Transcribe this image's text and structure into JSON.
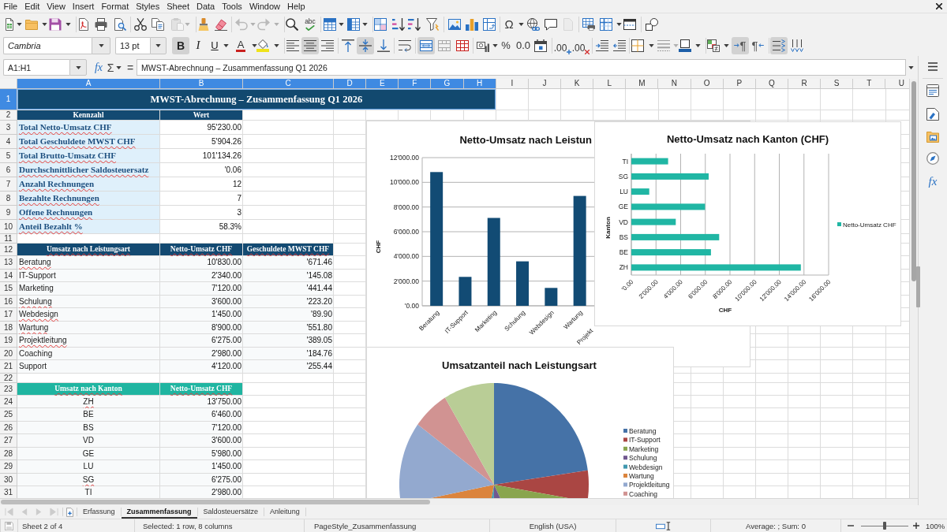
{
  "menu_bar": {
    "items": [
      "File",
      "Edit",
      "View",
      "Insert",
      "Format",
      "Styles",
      "Sheet",
      "Data",
      "Tools",
      "Window",
      "Help"
    ]
  },
  "standard_toolbar": {
    "paste_disabled": true,
    "undo_disabled": true,
    "redo_disabled": true,
    "spelling_glyph": "abc",
    "special_character_glyph": "Ω",
    "header_footer_disabled": true
  },
  "formatting_toolbar": {
    "font_name": "Cambria",
    "font_size": "13 pt",
    "bold": {
      "glyph": "B",
      "on": true
    },
    "italic": {
      "glyph": "I",
      "on": false
    },
    "underline": {
      "glyph": "U",
      "on": false
    },
    "font_color_glyph": "A",
    "align_left": false,
    "align_center": true,
    "align_right": false,
    "align_top": false,
    "align_middle": true,
    "align_bottom": false,
    "wrap_text": false,
    "merge_and_center": true,
    "percent_glyph": "%",
    "number_glyph": "0.0",
    "add_decimal_glyph": ".00",
    "delete_decimal_glyph": ".00",
    "left_to_right": {
      "glyph": "¶",
      "on": true
    },
    "right_to_left": {
      "glyph": "¶",
      "on": false
    },
    "text_left_to_right": true,
    "text_vertical": false
  },
  "formula_bar": {
    "name_box": "A1:H1",
    "function_wizard_glyph": "fx",
    "sum_glyph": "Σ",
    "formula_glyph": "=",
    "content": "MWST-Abrechnung – Zusammenfassung Q1 2026"
  },
  "sidebar": {
    "functions_glyph": "fx"
  },
  "sheet": {
    "columns": [
      {
        "label": "A",
        "selected": true
      },
      {
        "label": "B",
        "selected": true
      },
      {
        "label": "C",
        "selected": true
      },
      {
        "label": "D",
        "selected": true
      },
      {
        "label": "E",
        "selected": true
      },
      {
        "label": "F",
        "selected": true
      },
      {
        "label": "G",
        "selected": true
      },
      {
        "label": "H",
        "selected": true
      },
      {
        "label": "I",
        "selected": false
      },
      {
        "label": "J",
        "selected": false
      },
      {
        "label": "K",
        "selected": false
      },
      {
        "label": "L",
        "selected": false
      },
      {
        "label": "M",
        "selected": false
      },
      {
        "label": "N",
        "selected": false
      },
      {
        "label": "O",
        "selected": false
      },
      {
        "label": "P",
        "selected": false
      },
      {
        "label": "Q",
        "selected": false
      },
      {
        "label": "R",
        "selected": false
      },
      {
        "label": "S",
        "selected": false
      },
      {
        "label": "T",
        "selected": false
      },
      {
        "label": "U",
        "selected": false
      }
    ],
    "rows": [
      {
        "label": "1",
        "selected": true
      },
      {
        "label": "2",
        "selected": false
      },
      {
        "label": "3",
        "selected": false
      },
      {
        "label": "4",
        "selected": false
      },
      {
        "label": "5",
        "selected": false
      },
      {
        "label": "6",
        "selected": false
      },
      {
        "label": "7",
        "selected": false
      },
      {
        "label": "8",
        "selected": false
      },
      {
        "label": "9",
        "selected": false
      },
      {
        "label": "10",
        "selected": false
      },
      {
        "label": "11",
        "selected": false
      },
      {
        "label": "12",
        "selected": false
      },
      {
        "label": "13",
        "selected": false
      },
      {
        "label": "14",
        "selected": false
      },
      {
        "label": "15",
        "selected": false
      },
      {
        "label": "16",
        "selected": false
      },
      {
        "label": "17",
        "selected": false
      },
      {
        "label": "18",
        "selected": false
      },
      {
        "label": "19",
        "selected": false
      },
      {
        "label": "20",
        "selected": false
      },
      {
        "label": "21",
        "selected": false
      },
      {
        "label": "22",
        "selected": false
      },
      {
        "label": "23",
        "selected": false
      },
      {
        "label": "24",
        "selected": false
      },
      {
        "label": "25",
        "selected": false
      },
      {
        "label": "26",
        "selected": false
      },
      {
        "label": "27",
        "selected": false
      },
      {
        "label": "28",
        "selected": false
      },
      {
        "label": "29",
        "selected": false
      },
      {
        "label": "30",
        "selected": false
      },
      {
        "label": "31",
        "selected": false
      }
    ],
    "title": {
      "text": "MWST-Abrechnung – Zusammenfassung Q1 2026",
      "selected": true
    },
    "tables": [
      {
        "kind": "kpi",
        "header": [
          {
            "text": "Kennzahl",
            "spelling_marked": false
          },
          {
            "text": "Wert",
            "spelling_marked": false
          }
        ],
        "rows": [
          {
            "cells": [
              "Total Netto-Umsatz CHF",
              "95'230.00"
            ],
            "spelling_marked": true
          },
          {
            "cells": [
              "Total Geschuldete MWST CHF",
              "5'904.26"
            ],
            "spelling_marked": true
          },
          {
            "cells": [
              "Total Brutto-Umsatz CHF",
              "101'134.26"
            ],
            "spelling_marked": true
          },
          {
            "cells": [
              "Durchschnittlicher Saldosteuersatz",
              "'0.06"
            ],
            "spelling_marked": true
          },
          {
            "cells": [
              "Anzahl Rechnungen",
              "12"
            ],
            "spelling_marked": true
          },
          {
            "cells": [
              "Bezahlte Rechnungen",
              "7"
            ],
            "spelling_marked": true
          },
          {
            "cells": [
              "Offene Rechnungen",
              "3"
            ],
            "spelling_marked": true
          },
          {
            "cells": [
              "Anteil Bezahlt %",
              "58.3%"
            ],
            "spelling_marked": true
          }
        ]
      },
      {
        "kind": "service",
        "header": [
          {
            "text": "Umsatz nach Leistungsart",
            "spelling_marked": true
          },
          {
            "text": "Netto-Umsatz CHF",
            "spelling_marked": true
          },
          {
            "text": "Geschuldete MWST CHF",
            "spelling_marked": true
          }
        ],
        "rows": [
          {
            "cells": [
              "Beratung",
              "10'830.00",
              "'671.46"
            ],
            "spelling_marked": true
          },
          {
            "cells": [
              "IT-Support",
              "2'340.00",
              "'145.08"
            ],
            "spelling_marked": false
          },
          {
            "cells": [
              "Marketing",
              "7'120.00",
              "'441.44"
            ],
            "spelling_marked": false
          },
          {
            "cells": [
              "Schulung",
              "3'600.00",
              "'223.20"
            ],
            "spelling_marked": true
          },
          {
            "cells": [
              "Webdesign",
              "1'450.00",
              "'89.90"
            ],
            "spelling_marked": true
          },
          {
            "cells": [
              "Wartung",
              "8'900.00",
              "'551.80"
            ],
            "spelling_marked": true
          },
          {
            "cells": [
              "Projektleitung",
              "6'275.00",
              "'389.05"
            ],
            "spelling_marked": true
          },
          {
            "cells": [
              "Coaching",
              "2'980.00",
              "'184.76"
            ],
            "spelling_marked": false
          },
          {
            "cells": [
              "Support",
              "4'120.00",
              "'255.44"
            ],
            "spelling_marked": false
          }
        ]
      },
      {
        "kind": "canton",
        "header": [
          {
            "text": "Umsatz nach Kanton",
            "spelling_marked": true
          },
          {
            "text": "Netto-Umsatz CHF",
            "spelling_marked": true
          }
        ],
        "rows": [
          {
            "cells": [
              "ZH",
              "13'750.00"
            ],
            "spelling_marked": true
          },
          {
            "cells": [
              "BE",
              "6'460.00"
            ],
            "spelling_marked": false
          },
          {
            "cells": [
              "BS",
              "7'120.00"
            ],
            "spelling_marked": false
          },
          {
            "cells": [
              "VD",
              "3'600.00"
            ],
            "spelling_marked": false
          },
          {
            "cells": [
              "GE",
              "5'980.00"
            ],
            "spelling_marked": false
          },
          {
            "cells": [
              "LU",
              "1'450.00"
            ],
            "spelling_marked": false
          },
          {
            "cells": [
              "SG",
              "6'275.00"
            ],
            "spelling_marked": true
          },
          {
            "cells": [
              "TI",
              "2'980.00"
            ],
            "spelling_marked": false
          }
        ]
      }
    ],
    "charts": [
      {
        "chart_data": {
          "type": "bar",
          "title": "Netto-Umsatz nach Leistun",
          "ylabel": "CHF",
          "categories": [
            "Beratung",
            "IT-Support",
            "Marketing",
            "Schulung",
            "Webdesign",
            "Wartung"
          ],
          "series": [
            {
              "color": "#124b74",
              "values": [
                10830,
                2340,
                7120,
                3600,
                1450,
                8900
              ]
            }
          ],
          "ylim": [
            0,
            12000
          ],
          "yticks": [
            {
              "value": 0,
              "label": "'0.00"
            },
            {
              "value": 2000,
              "label": "2'000.00"
            },
            {
              "value": 4000,
              "label": "4'000.00"
            },
            {
              "value": 6000,
              "label": "6'000.00"
            },
            {
              "value": 8000,
              "label": "8'000.00"
            },
            {
              "value": 10000,
              "label": "10'000.00"
            },
            {
              "value": 12000,
              "label": "12'000.00"
            }
          ],
          "grid": true
        },
        "cut_axis_label": "Projekt"
      },
      {
        "chart_data": {
          "type": "bar",
          "orientation": "horizontal",
          "title": "Netto-Umsatz nach Kanton (CHF)",
          "xlabel": "CHF",
          "ylabel": "Kanton",
          "categories": [
            "TI",
            "SG",
            "LU",
            "GE",
            "VD",
            "BS",
            "BE",
            "ZH"
          ],
          "series": [
            {
              "name": "Netto-Umsatz CHF",
              "color": "#20b6a4",
              "values": [
                2980,
                6275,
                1450,
                5980,
                3600,
                7120,
                6460,
                13750
              ]
            }
          ],
          "xlim": [
            0,
            16000
          ],
          "xticks": [
            {
              "value": 0,
              "label": "'0.00"
            },
            {
              "value": 2000,
              "label": "2'000.00"
            },
            {
              "value": 4000,
              "label": "4'000.00"
            },
            {
              "value": 6000,
              "label": "6'000.00"
            },
            {
              "value": 8000,
              "label": "8'000.00"
            },
            {
              "value": 10000,
              "label": "10'000.00"
            },
            {
              "value": 12000,
              "label": "12'000.00"
            },
            {
              "value": 14000,
              "label": "14'000.00"
            },
            {
              "value": 16000,
              "label": "16'000.00"
            }
          ],
          "grid": true
        }
      },
      {
        "kind": "pie",
        "title": "Umsatzanteil nach Leistungsart",
        "slices": [
          {
            "color": "#4572a7"
          },
          {
            "color": "#aa4643"
          },
          {
            "color": "#89a54e"
          },
          {
            "color": "#71588f"
          },
          {
            "color": "#4198af"
          },
          {
            "color": "#db843d"
          },
          {
            "color": "#93a9cf"
          },
          {
            "color": "#d19392"
          },
          {
            "color": "#b9cd96"
          }
        ],
        "legend": [
          {
            "label": "Beratung",
            "color": "#4572a7"
          },
          {
            "label": "IT-Support",
            "color": "#aa4643"
          },
          {
            "label": "Marketing",
            "color": "#89a54e"
          },
          {
            "label": "Schulung",
            "color": "#71588f"
          },
          {
            "label": "Webdesign",
            "color": "#4198af"
          },
          {
            "label": "Wartung",
            "color": "#db843d"
          },
          {
            "label": "Projektleitung",
            "color": "#93a9cf"
          },
          {
            "label": "Coaching",
            "color": "#d19392"
          }
        ]
      }
    ]
  },
  "sheet_tabs": {
    "navigation_disabled": true,
    "tabs": [
      {
        "label": "Erfassung",
        "selected": false
      },
      {
        "label": "Zusammenfassung",
        "selected": true
      },
      {
        "label": "Saldosteuersätze",
        "selected": false
      },
      {
        "label": "Anleitung",
        "selected": false
      }
    ]
  },
  "status_bar": {
    "sheet_position": "Sheet 2 of 4",
    "selection": "Selected: 1 row, 8 columns",
    "page_style": "PageStyle_Zusammenfassung",
    "language": "English (USA)",
    "summary": "Average: ; Sum: 0",
    "zoom": {
      "level": 0.5,
      "reading": "100%"
    }
  }
}
